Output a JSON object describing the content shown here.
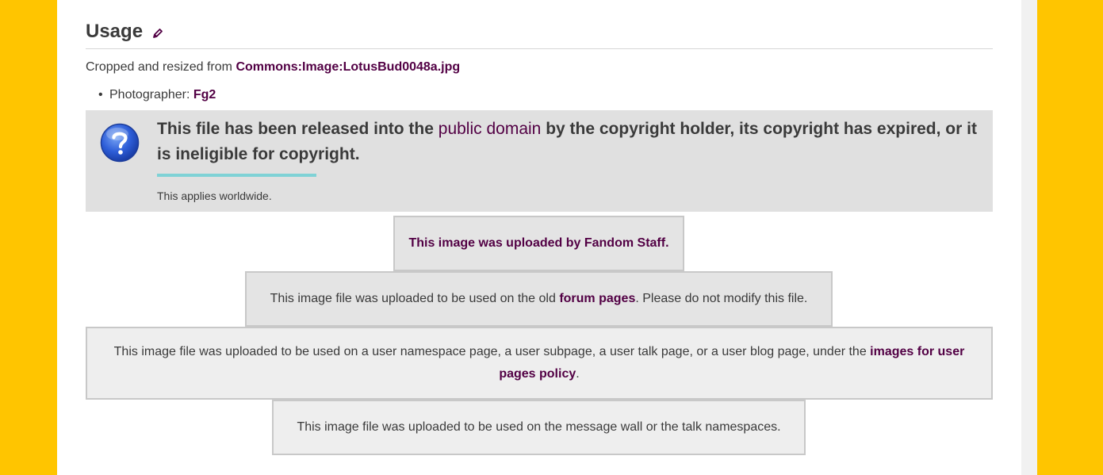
{
  "section": {
    "title": "Usage",
    "edit_icon": "pencil-icon"
  },
  "source": {
    "prefix": "Cropped and resized from ",
    "link": "Commons:Image:LotusBud0048a.jpg"
  },
  "photographer": {
    "label": "Photographer: ",
    "name": "Fg2"
  },
  "public_domain": {
    "icon": "question-mark-icon",
    "text_before": "This file has been released into the ",
    "link": "public domain",
    "text_after": " by the copyright holder, its copyright has expired, or it is ineligible for copyright.",
    "note": "This applies worldwide.",
    "accent_color": "#7fd2d6"
  },
  "notices": {
    "staff": "This image was uploaded by Fandom Staff.",
    "forum": {
      "before": "This image file was uploaded to be used on the old ",
      "link": "forum pages",
      "after": ". Please do not modify this file."
    },
    "user": {
      "before": "This image file was uploaded to be used on a user namespace page, a user subpage, a user talk page, or a user blog page, under the ",
      "link": "images for user pages policy",
      "after": "."
    },
    "wall": "This image file was uploaded to be used on the message wall or the talk namespaces."
  },
  "colors": {
    "background": "#ffc500",
    "link": "#520044",
    "text": "#3a3a3a"
  }
}
